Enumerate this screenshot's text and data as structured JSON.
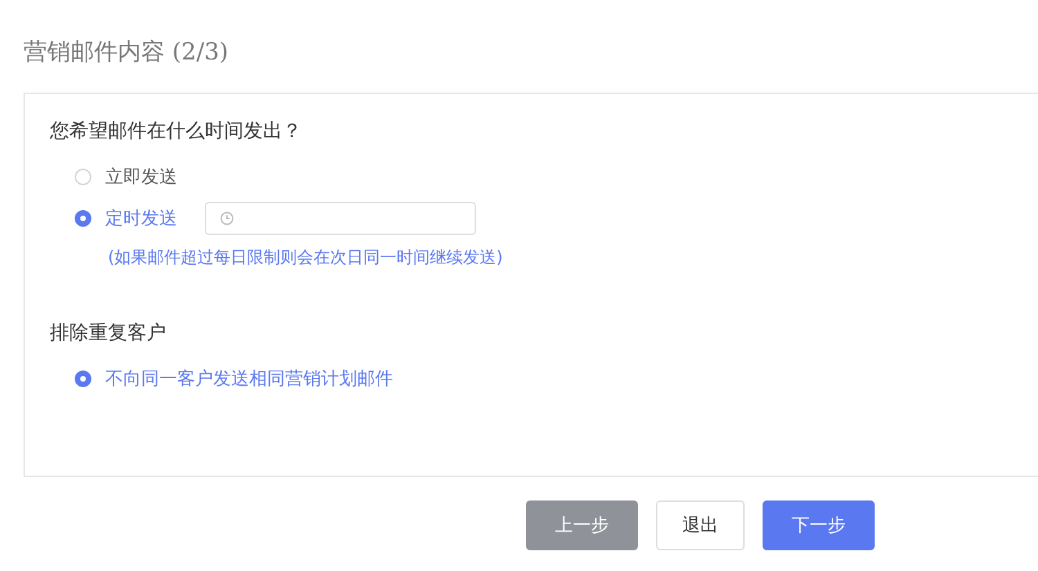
{
  "title": "营销邮件内容 (2/3)",
  "sections": [
    {
      "heading": "您希望邮件在什么时间发出？",
      "options": [
        {
          "label": "立即发送",
          "selected": false
        },
        {
          "label": "定时发送",
          "selected": true,
          "kind": "time"
        }
      ],
      "note": "(如果邮件超过每日限制则会在次日同一时间继续发送)"
    },
    {
      "heading": "排除重复客户",
      "options": [
        {
          "label": "不向同一客户发送相同营销计划邮件",
          "selected": true
        }
      ]
    }
  ],
  "buttons": [
    {
      "label": "上一步",
      "kind": "secondary"
    },
    {
      "label": "退出",
      "kind": "outline"
    },
    {
      "label": "下一步",
      "kind": "primary"
    }
  ]
}
